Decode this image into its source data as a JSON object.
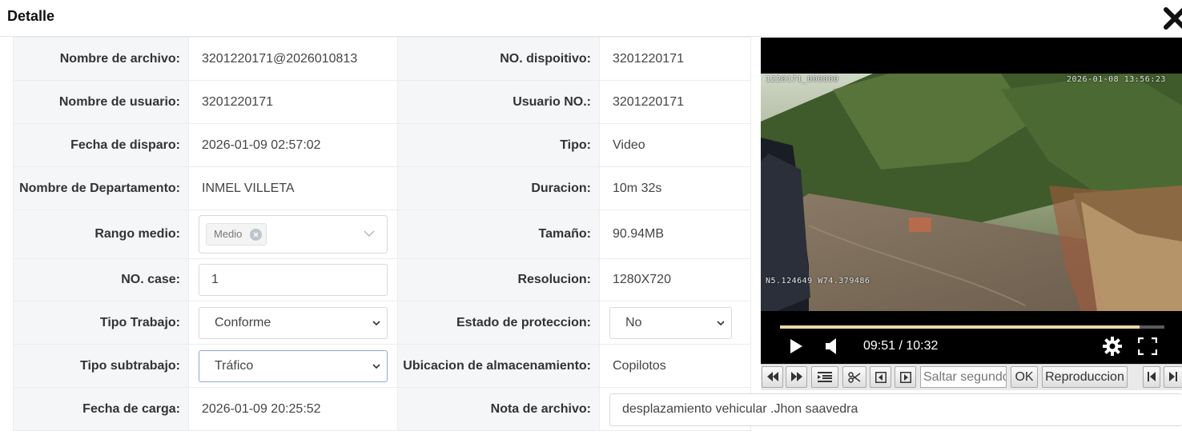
{
  "dialog": {
    "title": "Detalle"
  },
  "labels": {
    "file_name": "Nombre de archivo:",
    "device_no": "NO. dispoitivo:",
    "user_name": "Nombre de usuario:",
    "user_no": "Usuario NO.:",
    "capture_date": "Fecha de disparo:",
    "type": "Tipo:",
    "department": "Nombre de Departamento:",
    "duration": "Duracion:",
    "media_range": "Rango medio:",
    "size": "Tamaño:",
    "case_no": "NO. case:",
    "resolution": "Resolucion:",
    "work_type": "Tipo Trabajo:",
    "protection_state": "Estado de proteccion:",
    "sub_work_type": "Tipo subtrabajo:",
    "storage_location": "Ubicacion de almacenamiento:",
    "upload_date": "Fecha de carga:",
    "file_note": "Nota de archivo:"
  },
  "values": {
    "file_name": "3201220171@2026010813",
    "device_no": "3201220171",
    "user_name": "3201220171",
    "user_no": "3201220171",
    "capture_date": "2026-01-09 02:57:02",
    "type": "Video",
    "department": "INMEL VILLETA",
    "duration": "10m 32s",
    "media_range_tag": "Medio",
    "size": "90.94MB",
    "case_no": "1",
    "resolution": "1280X720",
    "work_type": "Conforme",
    "protection_state": "No",
    "sub_work_type": "Tráfico",
    "storage_location": "Copilotos",
    "upload_date": "2026-01-09 20:25:52",
    "file_note": "desplazamiento vehicular .Jhon saavedra"
  },
  "video": {
    "osd_id": "1220171_000000",
    "osd_datetime": "2026-01-08  13:56:23",
    "osd_gps": "N5.124649 W74.379486",
    "time_display": "09:51 / 10:32",
    "progress": 0.935,
    "progress_color": "#e8d9a6"
  },
  "toolbar": {
    "seek_placeholder": "Saltar segundo",
    "ok_label": "OK",
    "playback_label": "Reproduccion"
  },
  "icons": {
    "close": "close-icon",
    "play": "play-icon",
    "volume": "volume-icon",
    "settings": "gear-icon",
    "fullscreen": "fullscreen-icon",
    "chevron": "chevron-down-icon"
  }
}
